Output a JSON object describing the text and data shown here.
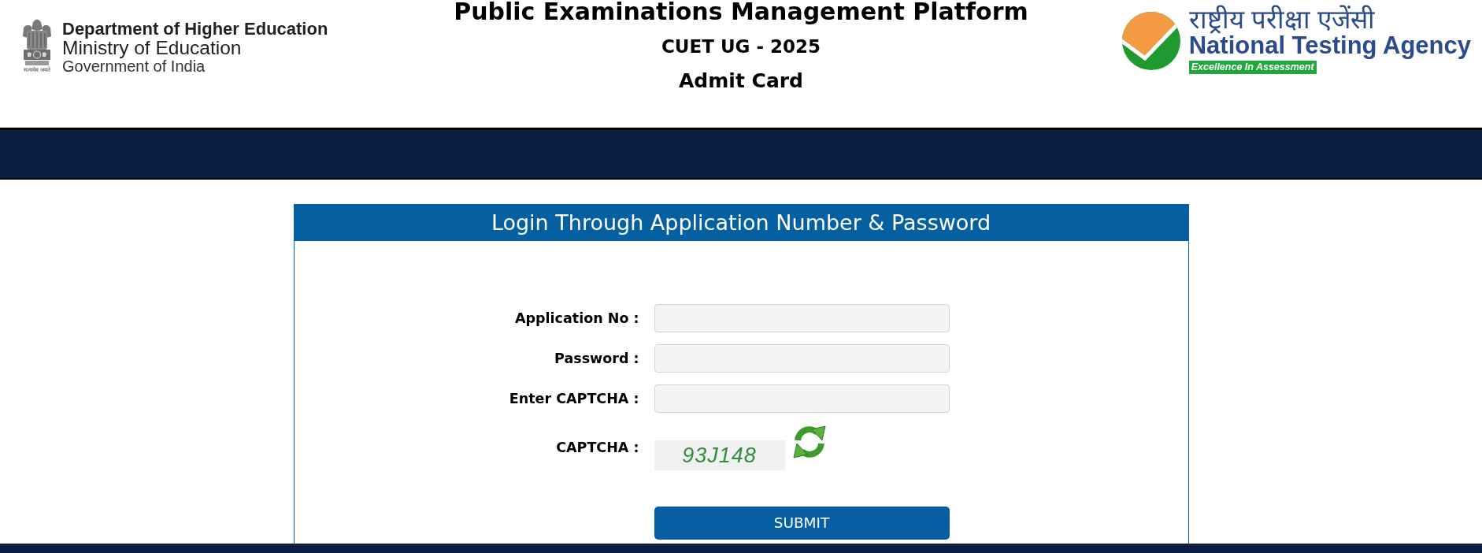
{
  "header": {
    "ministry": {
      "motto": "सत्यमेव जयते",
      "department": "Department of Higher Education",
      "ministry": "Ministry of Education",
      "government": "Government of India"
    },
    "titles": [
      "Public Examinations Management Platform",
      "CUET UG - 2025",
      "Admit Card"
    ],
    "agency": {
      "hindi_name": "राष्ट्रीय परीक्षा एजेंसी",
      "name": "National Testing Agency",
      "tagline": "Excellence In Assessment"
    }
  },
  "login_form": {
    "title": "Login Through Application Number & Password",
    "fields": [
      {
        "label": "Application No :"
      },
      {
        "label": "Password :"
      },
      {
        "label": "Enter CAPTCHA :"
      }
    ],
    "captcha": {
      "label": "CAPTCHA :",
      "code": "93J148"
    },
    "submit": "SUBMIT"
  }
}
